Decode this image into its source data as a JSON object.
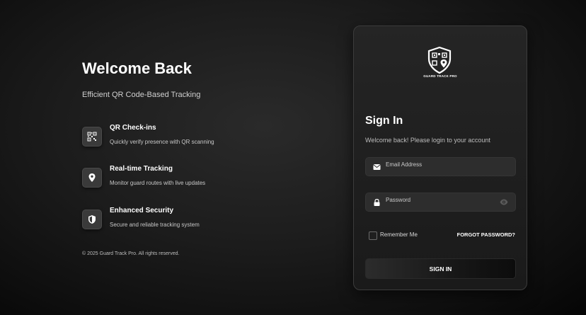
{
  "left": {
    "title": "Welcome Back",
    "subtitle": "Efficient QR Code-Based Tracking",
    "features": [
      {
        "title": "QR Check-ins",
        "desc": "Quickly verify presence with QR scanning",
        "icon": "qr-code-icon"
      },
      {
        "title": "Real-time Tracking",
        "desc": "Monitor guard routes with live updates",
        "icon": "location-pin-icon"
      },
      {
        "title": "Enhanced Security",
        "desc": "Secure and reliable tracking system",
        "icon": "shield-icon"
      }
    ],
    "copyright": "© 2025 Guard Track Pro. All rights reserved."
  },
  "card": {
    "brand": "GUARD TRACK PRO",
    "title": "Sign In",
    "subtitle": "Welcome back! Please login to your account",
    "email_label": "Email Address",
    "password_label": "Password",
    "remember_label": "Remember Me",
    "forgot_label": "FORGOT PASSWORD?",
    "submit_label": "SIGN IN"
  }
}
